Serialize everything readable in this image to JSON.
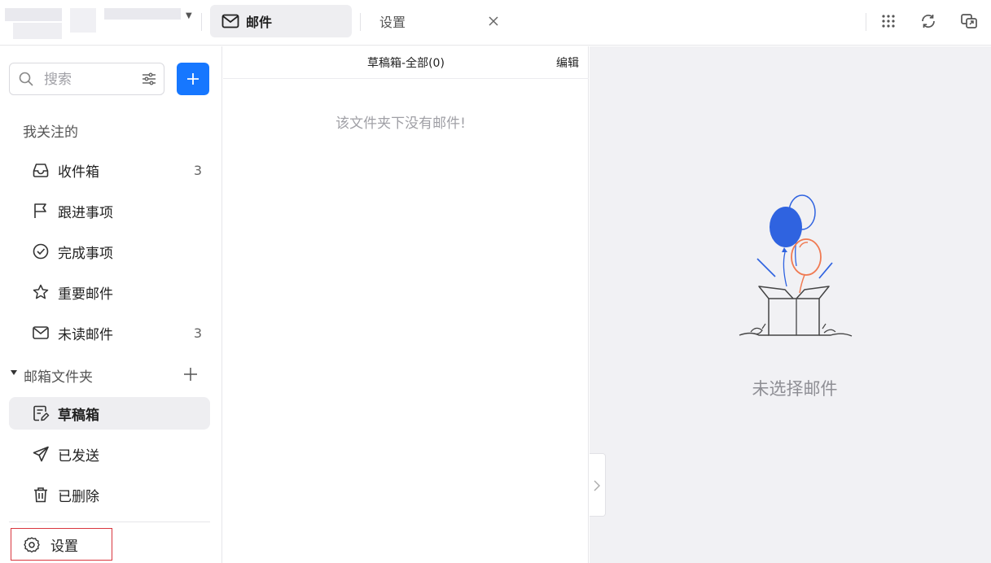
{
  "header": {
    "tabs": [
      {
        "label": "邮件",
        "icon": "mail-icon",
        "active": true
      },
      {
        "label": "设置",
        "icon": "",
        "active": false
      }
    ],
    "actions": [
      "apps-grid-icon",
      "refresh-icon",
      "switch-window-icon"
    ]
  },
  "sidebar": {
    "search": {
      "placeholder": "搜索"
    },
    "compose_icon": "plus-icon",
    "favorites_label": "我关注的",
    "favorites": [
      {
        "label": "收件箱",
        "count": "3",
        "icon": "inbox-icon"
      },
      {
        "label": "跟进事项",
        "count": "",
        "icon": "flag-icon"
      },
      {
        "label": "完成事项",
        "count": "",
        "icon": "check-circle-icon"
      },
      {
        "label": "重要邮件",
        "count": "",
        "icon": "star-icon"
      },
      {
        "label": "未读邮件",
        "count": "3",
        "icon": "mail-icon"
      }
    ],
    "folders_label": "邮箱文件夹",
    "folders": [
      {
        "label": "草稿箱",
        "icon": "draft-icon",
        "active": true
      },
      {
        "label": "已发送",
        "icon": "send-icon",
        "active": false
      },
      {
        "label": "已删除",
        "icon": "trash-icon",
        "active": false
      }
    ],
    "settings_label": "设置"
  },
  "list": {
    "title": "草稿箱-全部(0)",
    "edit_label": "编辑",
    "empty_message": "该文件夹下没有邮件!"
  },
  "reader": {
    "empty_message": "未选择邮件"
  },
  "colors": {
    "accent": "#1677ff",
    "balloon_blue": "#2f63e0",
    "balloon_orange": "#f07a52",
    "highlight_border": "#d9363e"
  }
}
